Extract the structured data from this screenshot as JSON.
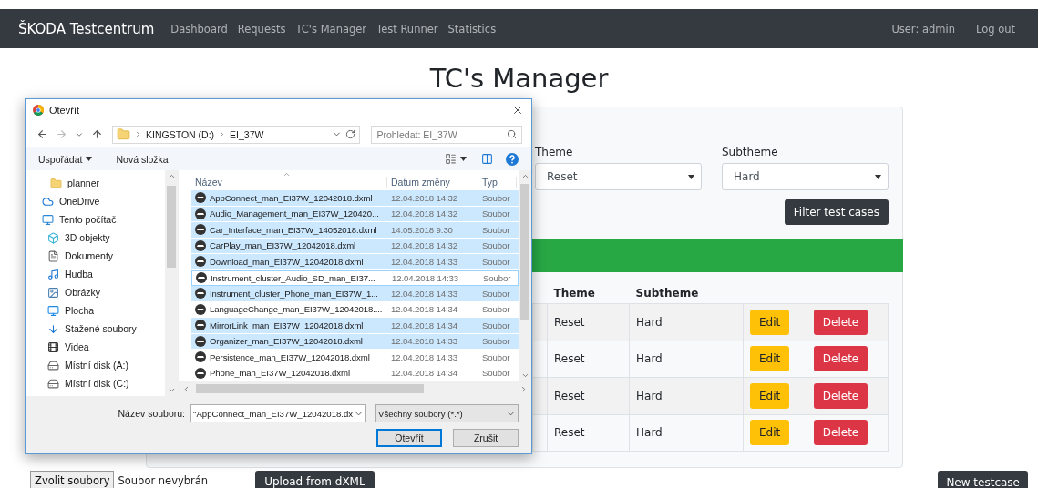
{
  "navbar": {
    "brand": "ŠKODA Testcentrum",
    "links": [
      "Dashboard",
      "Requests",
      "TC's Manager",
      "Test Runner",
      "Statistics"
    ],
    "user": "User: admin",
    "logout": "Log out"
  },
  "page_title": "TC's Manager",
  "filters": [
    {
      "label": "Theme",
      "value": "Reset"
    },
    {
      "label": "Subtheme",
      "value": "Hard"
    }
  ],
  "filter_button": "Filter test cases",
  "table": {
    "columns": [
      "Theme",
      "Subtheme"
    ],
    "rows": [
      {
        "theme": "Reset",
        "subtheme": "Hard",
        "edit": "Edit",
        "delete": "Delete"
      },
      {
        "theme": "Reset",
        "subtheme": "Hard",
        "edit": "Edit",
        "delete": "Delete"
      },
      {
        "theme": "Reset",
        "subtheme": "Hard",
        "edit": "Edit",
        "delete": "Delete"
      },
      {
        "theme": "Reset",
        "subtheme": "Hard",
        "edit": "Edit",
        "delete": "Delete"
      }
    ]
  },
  "upload": {
    "choose_button": "Zvolit soubory",
    "status": "Soubor nevybrán",
    "upload_button": "Upload from dXML"
  },
  "new_button": "New testcase",
  "dialog": {
    "title": "Otevřít",
    "path": [
      "KINGSTON (D:)",
      "EI_37W"
    ],
    "search_placeholder": "Prohledat: EI_37W",
    "toolbar": [
      "Uspořádat",
      "Nová složka"
    ],
    "quick_access": [
      {
        "label": "planner",
        "kind": "folder"
      }
    ],
    "nav": [
      {
        "label": "OneDrive",
        "kind": "cloud"
      },
      {
        "label": "Tento počítač",
        "kind": "computer",
        "children": [
          {
            "label": "3D objekty",
            "kind": "cube"
          },
          {
            "label": "Dokumenty",
            "kind": "document"
          },
          {
            "label": "Hudba",
            "kind": "music"
          },
          {
            "label": "Obrázky",
            "kind": "image"
          },
          {
            "label": "Plocha",
            "kind": "desktop"
          },
          {
            "label": "Stažené soubory",
            "kind": "download"
          },
          {
            "label": "Videa",
            "kind": "video"
          },
          {
            "label": "Místní disk (A:)",
            "kind": "drive"
          },
          {
            "label": "Místní disk (C:)",
            "kind": "drive"
          }
        ]
      }
    ],
    "columns": [
      "Název",
      "Datum změny",
      "Typ"
    ],
    "files": [
      {
        "name": "AppConnect_man_EI37W_12042018.dxml",
        "date": "12.04.2018 14:32",
        "type": "Soubor",
        "selected": true,
        "focused": false
      },
      {
        "name": "Audio_Management_man_EI37W_120420...",
        "date": "12.04.2018 14:32",
        "type": "Soubor",
        "selected": true,
        "focused": false
      },
      {
        "name": "Car_Interface_man_EI37W_14052018.dxml",
        "date": "14.05.2018 9:30",
        "type": "Soubor",
        "selected": true,
        "focused": false
      },
      {
        "name": "CarPlay_man_EI37W_12042018.dxml",
        "date": "12.04.2018 14:32",
        "type": "Soubor",
        "selected": true,
        "focused": false
      },
      {
        "name": "Download_man_EI37W_12042018.dxml",
        "date": "12.04.2018 14:33",
        "type": "Soubor",
        "selected": true,
        "focused": false
      },
      {
        "name": "Instrument_cluster_Audio_SD_man_EI37...",
        "date": "12.04.2018 14:33",
        "type": "Soubor",
        "selected": false,
        "focused": true
      },
      {
        "name": "Instrument_cluster_Phone_man_EI37W_1...",
        "date": "12.04.2018 14:33",
        "type": "Soubor",
        "selected": true,
        "focused": false
      },
      {
        "name": "LanguageChange_man_EI37W_12042018....",
        "date": "12.04.2018 14:34",
        "type": "Soubor",
        "selected": false,
        "focused": false
      },
      {
        "name": "MirrorLink_man_EI37W_12042018.dxml",
        "date": "12.04.2018 14:34",
        "type": "Soubor",
        "selected": true,
        "focused": false
      },
      {
        "name": "Organizer_man_EI37W_12042018.dxml",
        "date": "12.04.2018 14:33",
        "type": "Soubor",
        "selected": true,
        "focused": false
      },
      {
        "name": "Persistence_man_EI37W_12042018.dxml",
        "date": "12.04.2018 14:33",
        "type": "Soubor",
        "selected": false,
        "focused": false
      },
      {
        "name": "Phone_man_EI37W_12042018.dxml",
        "date": "12.04.2018 14:34",
        "type": "Soubor",
        "selected": false,
        "focused": false
      }
    ],
    "filename_label": "Název souboru:",
    "filename_value": "\"AppConnect_man_EI37W_12042018.dx",
    "filetype": "Všechny soubory (*.*)",
    "buttons": [
      {
        "label": "Otevřít",
        "default": true
      },
      {
        "label": "Zrušit",
        "default": false
      }
    ]
  }
}
